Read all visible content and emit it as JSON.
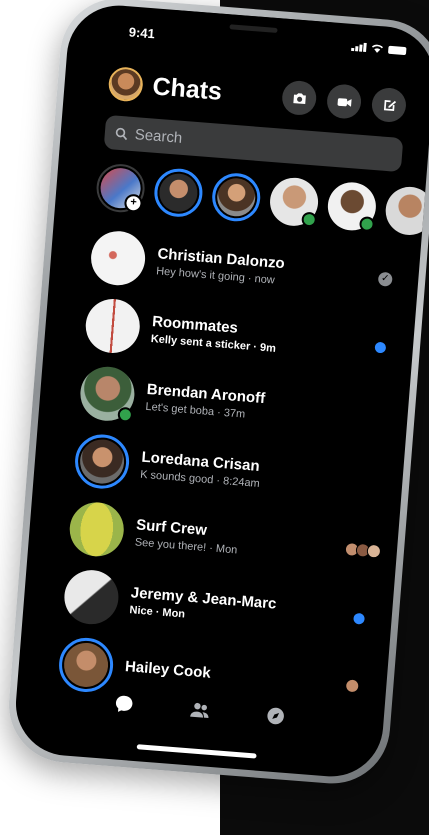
{
  "status": {
    "time": "9:41"
  },
  "header": {
    "title": "Chats"
  },
  "search": {
    "placeholder": "Search"
  },
  "colors": {
    "accent": "#2d88ff",
    "online": "#31a24c",
    "background": "#000000",
    "surface": "#3a3b3c"
  },
  "stories": [
    {
      "kind": "your-story"
    },
    {
      "kind": "story-ring"
    },
    {
      "kind": "story-ring"
    },
    {
      "kind": "online"
    },
    {
      "kind": "online"
    },
    {
      "kind": "plain"
    }
  ],
  "chats": [
    {
      "name": "Christian Dalonzo",
      "preview": "Hey how's it going · now",
      "status": "read"
    },
    {
      "name": "Roommates",
      "preview": "Kelly sent a sticker · 9m",
      "status": "unread"
    },
    {
      "name": "Brendan Aronoff",
      "preview": "Let's get boba · 37m",
      "status": "none"
    },
    {
      "name": "Loredana Crisan",
      "preview": "K sounds good · 8:24am",
      "status": "none"
    },
    {
      "name": "Surf Crew",
      "preview": "See you there! · Mon",
      "status": "seen-by-group"
    },
    {
      "name": "Jeremy & Jean-Marc",
      "preview": "Nice · Mon",
      "status": "unread"
    },
    {
      "name": "Hailey Cook",
      "preview": "",
      "status": "seen"
    }
  ],
  "tabs": [
    {
      "icon": "chat-bubble-icon"
    },
    {
      "icon": "people-icon"
    },
    {
      "icon": "compass-icon"
    }
  ]
}
